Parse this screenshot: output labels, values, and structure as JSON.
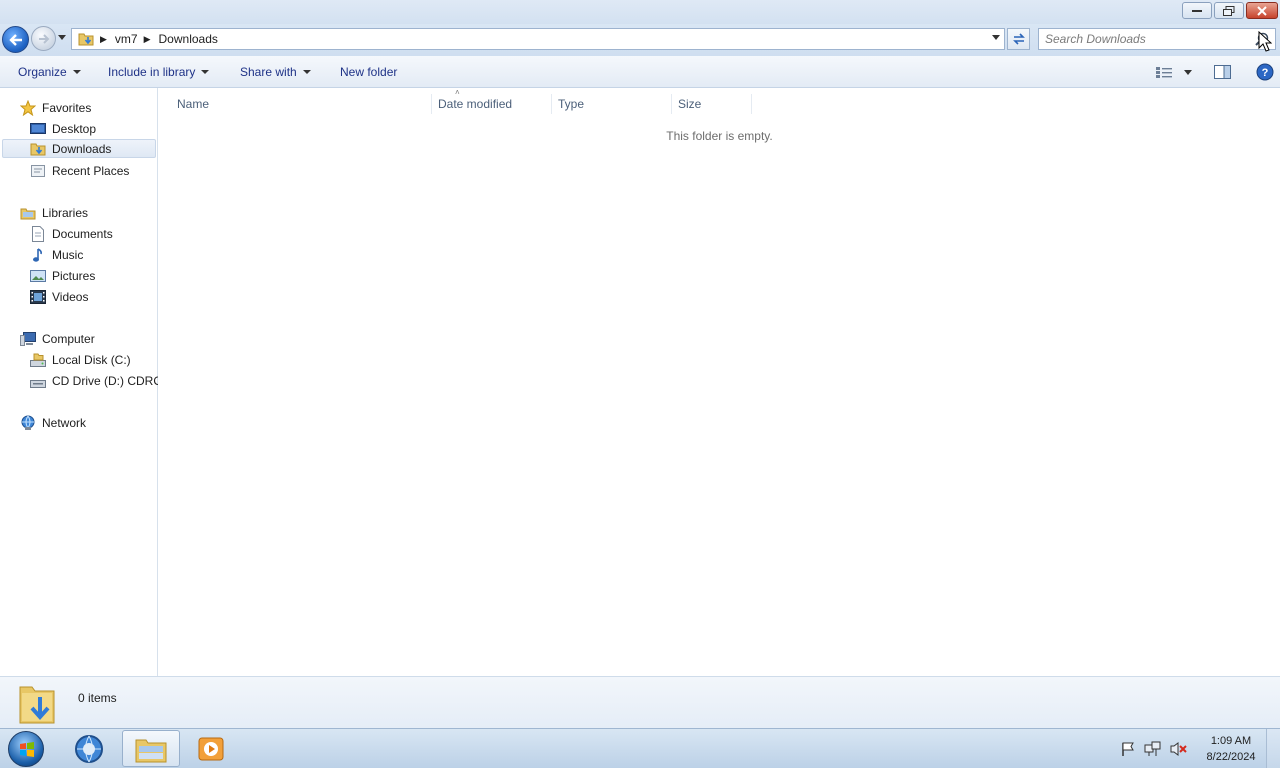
{
  "window": {
    "path": [
      "vm7",
      "Downloads"
    ],
    "search_placeholder": "Search Downloads"
  },
  "toolbar": {
    "organize": "Organize",
    "include_in_library": "Include in library",
    "share_with": "Share with",
    "new_folder": "New folder"
  },
  "nav": {
    "favorites": "Favorites",
    "desktop": "Desktop",
    "downloads": "Downloads",
    "recent_places": "Recent Places",
    "libraries": "Libraries",
    "documents": "Documents",
    "music": "Music",
    "pictures": "Pictures",
    "videos": "Videos",
    "computer": "Computer",
    "local_disk": "Local Disk (C:)",
    "cd_drive": "CD Drive (D:) CDROM",
    "network": "Network",
    "selected": "downloads"
  },
  "columns": {
    "name": "Name",
    "date_modified": "Date modified",
    "type": "Type",
    "size": "Size"
  },
  "content": {
    "empty_message": "This folder is empty."
  },
  "details": {
    "item_count": "0 items"
  },
  "taskbar": {
    "time": "1:09 AM",
    "date": "8/22/2024"
  },
  "colors": {
    "link_blue": "#1e3287",
    "close_red": "#c7432c",
    "selection": "#dfe8f4"
  }
}
